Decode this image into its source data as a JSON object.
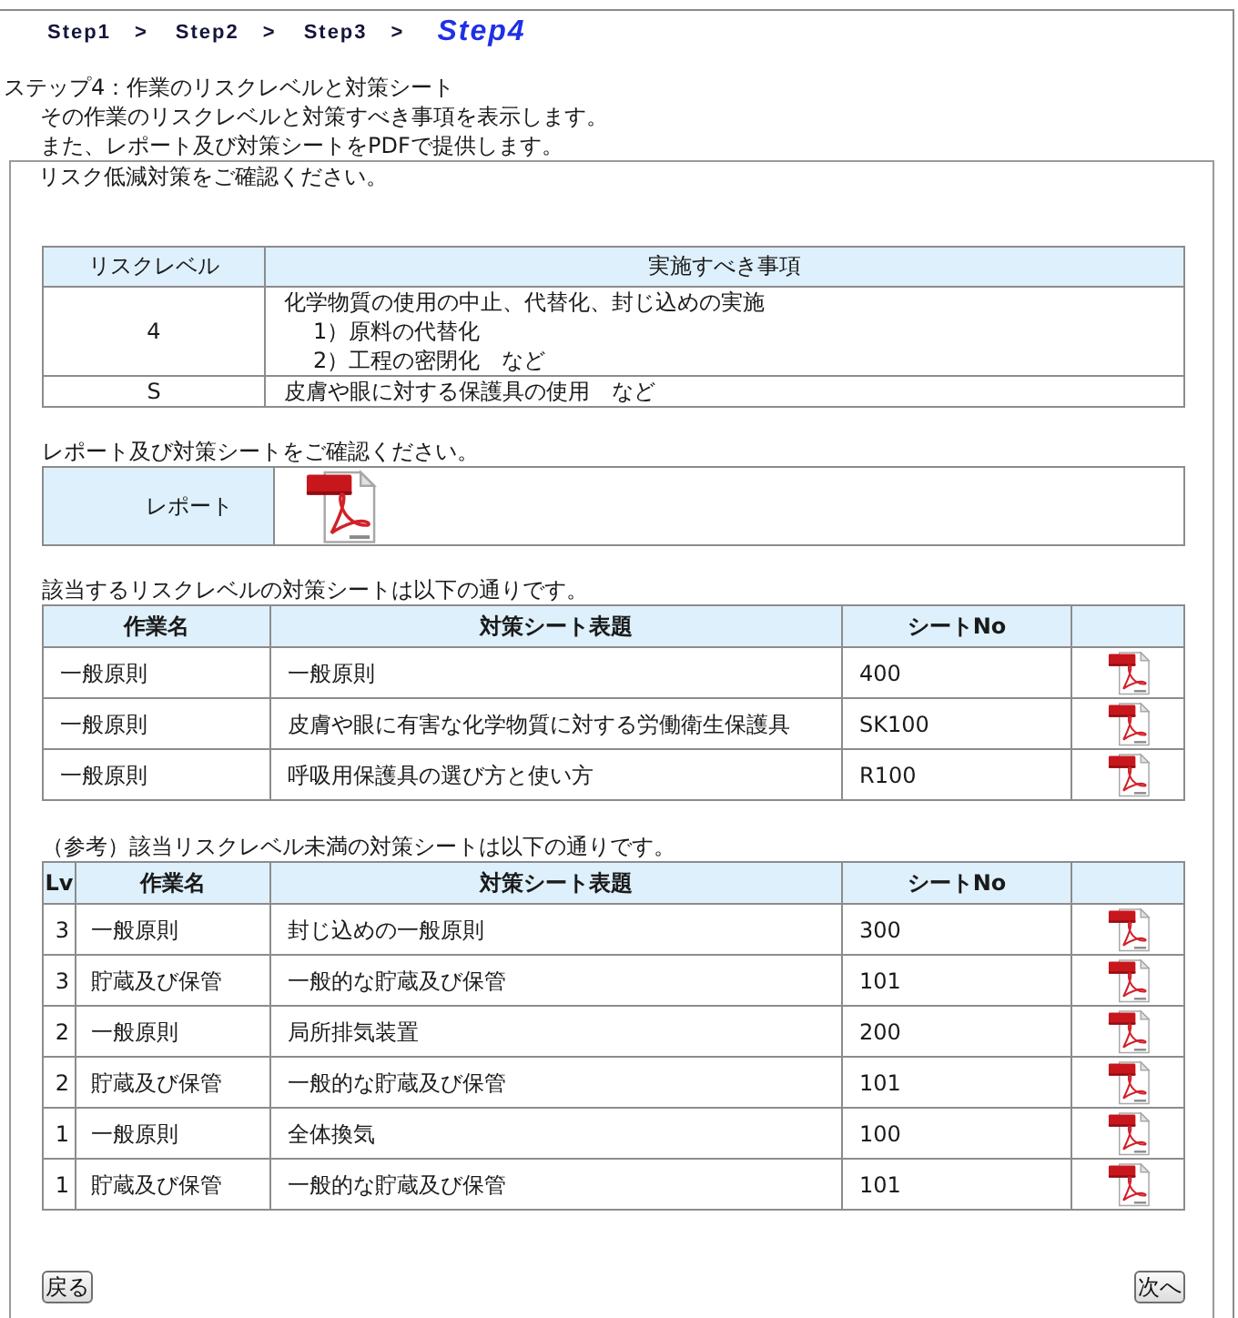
{
  "breadcrumb": [
    {
      "kind": "step",
      "label": "Step1",
      "selected": false
    },
    {
      "kind": "separator",
      "label": ">"
    },
    {
      "kind": "step",
      "label": "Step2",
      "selected": false
    },
    {
      "kind": "separator",
      "label": ">"
    },
    {
      "kind": "step",
      "label": "Step3",
      "selected": false
    },
    {
      "kind": "separator",
      "label": ">"
    },
    {
      "kind": "step",
      "label": "Step4",
      "selected": true
    }
  ],
  "intro": {
    "title": "ステップ4：作業のリスクレベルと対策シート",
    "lines": [
      "その作業のリスクレベルと対策すべき事項を表示します。",
      "また、レポート及び対策シートをPDFで提供します。"
    ]
  },
  "panel": {
    "notice": "リスク低減対策をご確認ください。",
    "risk_table": {
      "columns": [
        "リスクレベル",
        "実施すべき事項"
      ],
      "rows": [
        {
          "risk_level": "4",
          "measure": "化学物質の使用の中止、代替化、封じ込めの実施",
          "sub_items": [
            "1）原料の代替化",
            "2）工程の密閉化　など"
          ]
        },
        {
          "risk_level": "S",
          "measure": "皮膚や眼に対する保護具の使用　など"
        }
      ]
    },
    "report_caption": "レポート及び対策シートをご確認ください。",
    "report_table": {
      "label": "レポート"
    },
    "sheets_caption": "該当するリスクレベルの対策シートは以下の通りです。",
    "sheets_table": {
      "columns": [
        "作業名",
        "対策シート表題",
        "シートNo"
      ],
      "rows": [
        {
          "task": "一般原則",
          "title": "一般原則",
          "sheet_no": "400"
        },
        {
          "task": "一般原則",
          "title": "皮膚や眼に有害な化学物質に対する労働衛生保護具",
          "sheet_no": "SK100"
        },
        {
          "task": "一般原則",
          "title": "呼吸用保護具の選び方と使い方",
          "sheet_no": "R100"
        }
      ]
    },
    "reference_caption": "（参考）該当リスクレベル未満の対策シートは以下の通りです。",
    "reference_table": {
      "columns": [
        "Lv",
        "作業名",
        "対策シート表題",
        "シートNo"
      ],
      "rows": [
        {
          "lv": "3",
          "task": "一般原則",
          "title": "封じ込めの一般原則",
          "sheet_no": "300"
        },
        {
          "lv": "3",
          "task": "貯蔵及び保管",
          "title": "一般的な貯蔵及び保管",
          "sheet_no": "101"
        },
        {
          "lv": "2",
          "task": "一般原則",
          "title": "局所排気装置",
          "sheet_no": "200"
        },
        {
          "lv": "2",
          "task": "貯蔵及び保管",
          "title": "一般的な貯蔵及び保管",
          "sheet_no": "101"
        },
        {
          "lv": "1",
          "task": "一般原則",
          "title": "全体換気",
          "sheet_no": "100"
        },
        {
          "lv": "1",
          "task": "貯蔵及び保管",
          "title": "一般的な貯蔵及び保管",
          "sheet_no": "101"
        }
      ]
    },
    "buttons": {
      "back": "戻る",
      "next": "次へ"
    }
  }
}
